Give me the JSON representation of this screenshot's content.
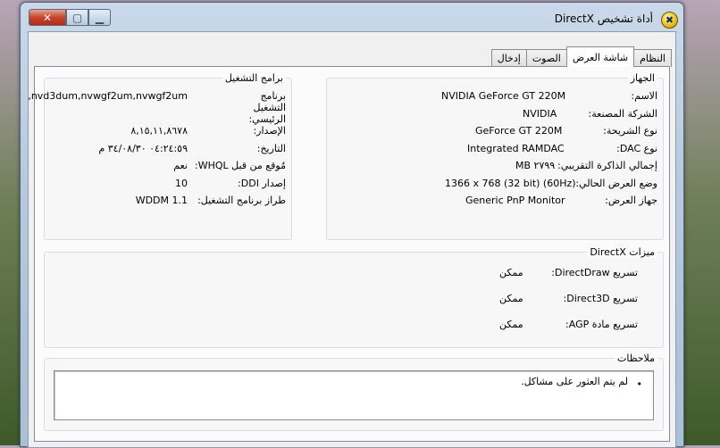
{
  "window": {
    "title": "أداة تشخيص DirectX"
  },
  "tabs": [
    {
      "label": "النظام"
    },
    {
      "label": "شاشة العرض"
    },
    {
      "label": "الصوت"
    },
    {
      "label": "إدخال"
    }
  ],
  "device": {
    "title": "الجهاز",
    "fields": [
      {
        "label": "الاسم:",
        "value": "NVIDIA GeForce GT 220M"
      },
      {
        "label": "الشركة المصنعة:",
        "value": "NVIDIA"
      },
      {
        "label": "نوع الشريحة:",
        "value": "GeForce GT 220M"
      },
      {
        "label": "نوع DAC:",
        "value": "Integrated RAMDAC"
      },
      {
        "label": "إجمالي الذاكرة التقريبي:",
        "value": "MB ٢٧٩٩"
      },
      {
        "label": "وضع العرض الحالي:",
        "value": "1366 x 768 (32 bit) (60Hz)"
      },
      {
        "label": "جهاز العرض:",
        "value": "Generic PnP Monitor"
      }
    ]
  },
  "drivers": {
    "title": "برامج التشغيل",
    "main_label": "برنامج التشغيل الرئيسي:",
    "main_value": "nvd3dum,nvwgf2um,nvwgf2um,",
    "fields": [
      {
        "label": "الإصدار:",
        "value": "٨,١٥,١١,٨٦٧٨"
      },
      {
        "label": "التاريخ:",
        "value": "٠٤:٢٤:٥٩ ٣٤/٠٨/٣٠ م"
      },
      {
        "label": "مُوقع من قبل WHQL:",
        "value": "نعم"
      },
      {
        "label": "إصدار DDI:",
        "value": "10"
      },
      {
        "label": "طراز برنامج التشغيل:",
        "value": "WDDM 1.1"
      }
    ]
  },
  "directx": {
    "title": "ميزات DirectX",
    "features": [
      {
        "label": "تسريع DirectDraw:",
        "value": "ممكن"
      },
      {
        "label": "تسريع Direct3D:",
        "value": "ممكن"
      },
      {
        "label": "تسريع مادة AGP:",
        "value": "ممكن"
      }
    ]
  },
  "notes": {
    "title": "ملاحظات",
    "items": [
      "لم يتم العثور على مشاكل."
    ]
  },
  "colors": {
    "titlebar": "#c9d9ea",
    "close": "#c7452d",
    "panel": "#fbfbfb"
  }
}
